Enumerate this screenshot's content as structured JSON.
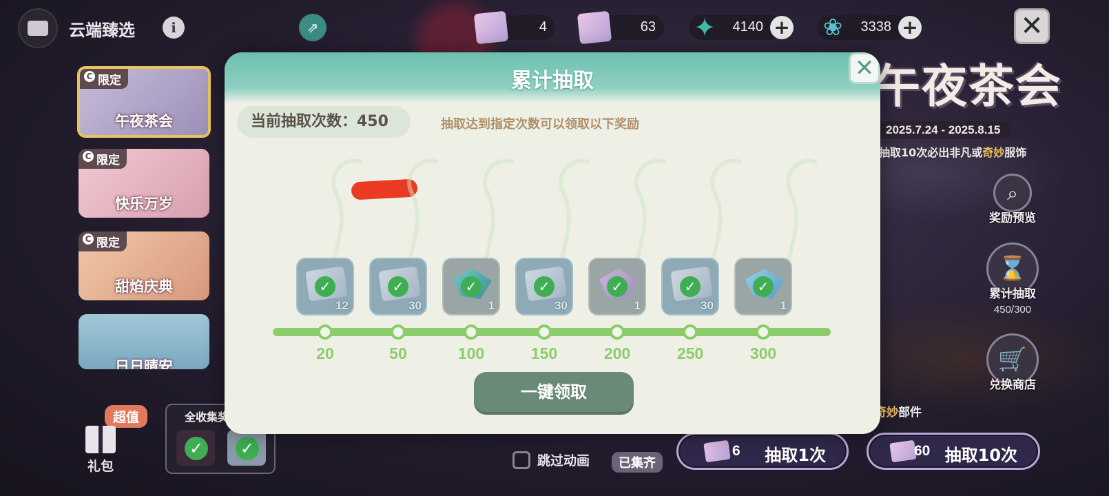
{
  "app": {
    "title": "云端臻选"
  },
  "resources": [
    {
      "icon": "draw-ticket-icon",
      "value": "4"
    },
    {
      "icon": "premium-ticket-icon",
      "value": "63"
    },
    {
      "icon": "star-gem-icon",
      "value": "4140"
    },
    {
      "icon": "butterfly-gem-icon",
      "value": "3338"
    }
  ],
  "banners": [
    {
      "tag": "限定",
      "name": "午夜茶会",
      "selected": true
    },
    {
      "tag": "限定",
      "name": "快乐万岁"
    },
    {
      "tag": "限定",
      "name": "甜焰庆典"
    },
    {
      "tag": "",
      "name": "日日晴安"
    }
  ],
  "gift": {
    "label": "礼包",
    "badge": "超值"
  },
  "collect": {
    "title": "全收集奖"
  },
  "event": {
    "title": "午夜茶会",
    "date": "2025.7.24 - 2025.8.15",
    "note_prefix": "抽取10次必出非凡或",
    "note_highlight": "奇妙",
    "note_suffix": "服饰"
  },
  "side_buttons": {
    "preview": "奖励预览",
    "cumulative": "累计抽取",
    "cumulative_progress": "450/300",
    "shop": "兑换商店"
  },
  "parts_banner": {
    "highlight": "奇妙",
    "text": "部件"
  },
  "draw": {
    "single_cost": "6",
    "single_label": "抽取1次",
    "ten_cost": "60",
    "ten_label": "抽取10次"
  },
  "skip": {
    "label": "跳过动画"
  },
  "collected_badge": "已集齐",
  "modal": {
    "title": "累计抽取",
    "count_label": "当前抽取次数：450",
    "hint": "抽取达到指定次数可以领取以下奖励",
    "claim_button": "一键领取",
    "close_icon": "close-icon",
    "rewards": [
      {
        "milestone": "20",
        "qty": "12",
        "type": "ticket",
        "claimed": true
      },
      {
        "milestone": "50",
        "qty": "30",
        "type": "ticket",
        "claimed": true
      },
      {
        "milestone": "100",
        "qty": "1",
        "type": "crystal-a",
        "claimed": true
      },
      {
        "milestone": "150",
        "qty": "30",
        "type": "ticket",
        "claimed": true
      },
      {
        "milestone": "200",
        "qty": "1",
        "type": "crystal-b",
        "claimed": true
      },
      {
        "milestone": "250",
        "qty": "30",
        "type": "ticket",
        "claimed": true
      },
      {
        "milestone": "300",
        "qty": "1",
        "type": "crystal-c",
        "claimed": true
      }
    ]
  },
  "colors": {
    "accent_green": "#8ccc6c",
    "header_teal": "#6cc0b0",
    "claim_button": "#6a8a78",
    "highlight_gold": "#f0c060"
  }
}
